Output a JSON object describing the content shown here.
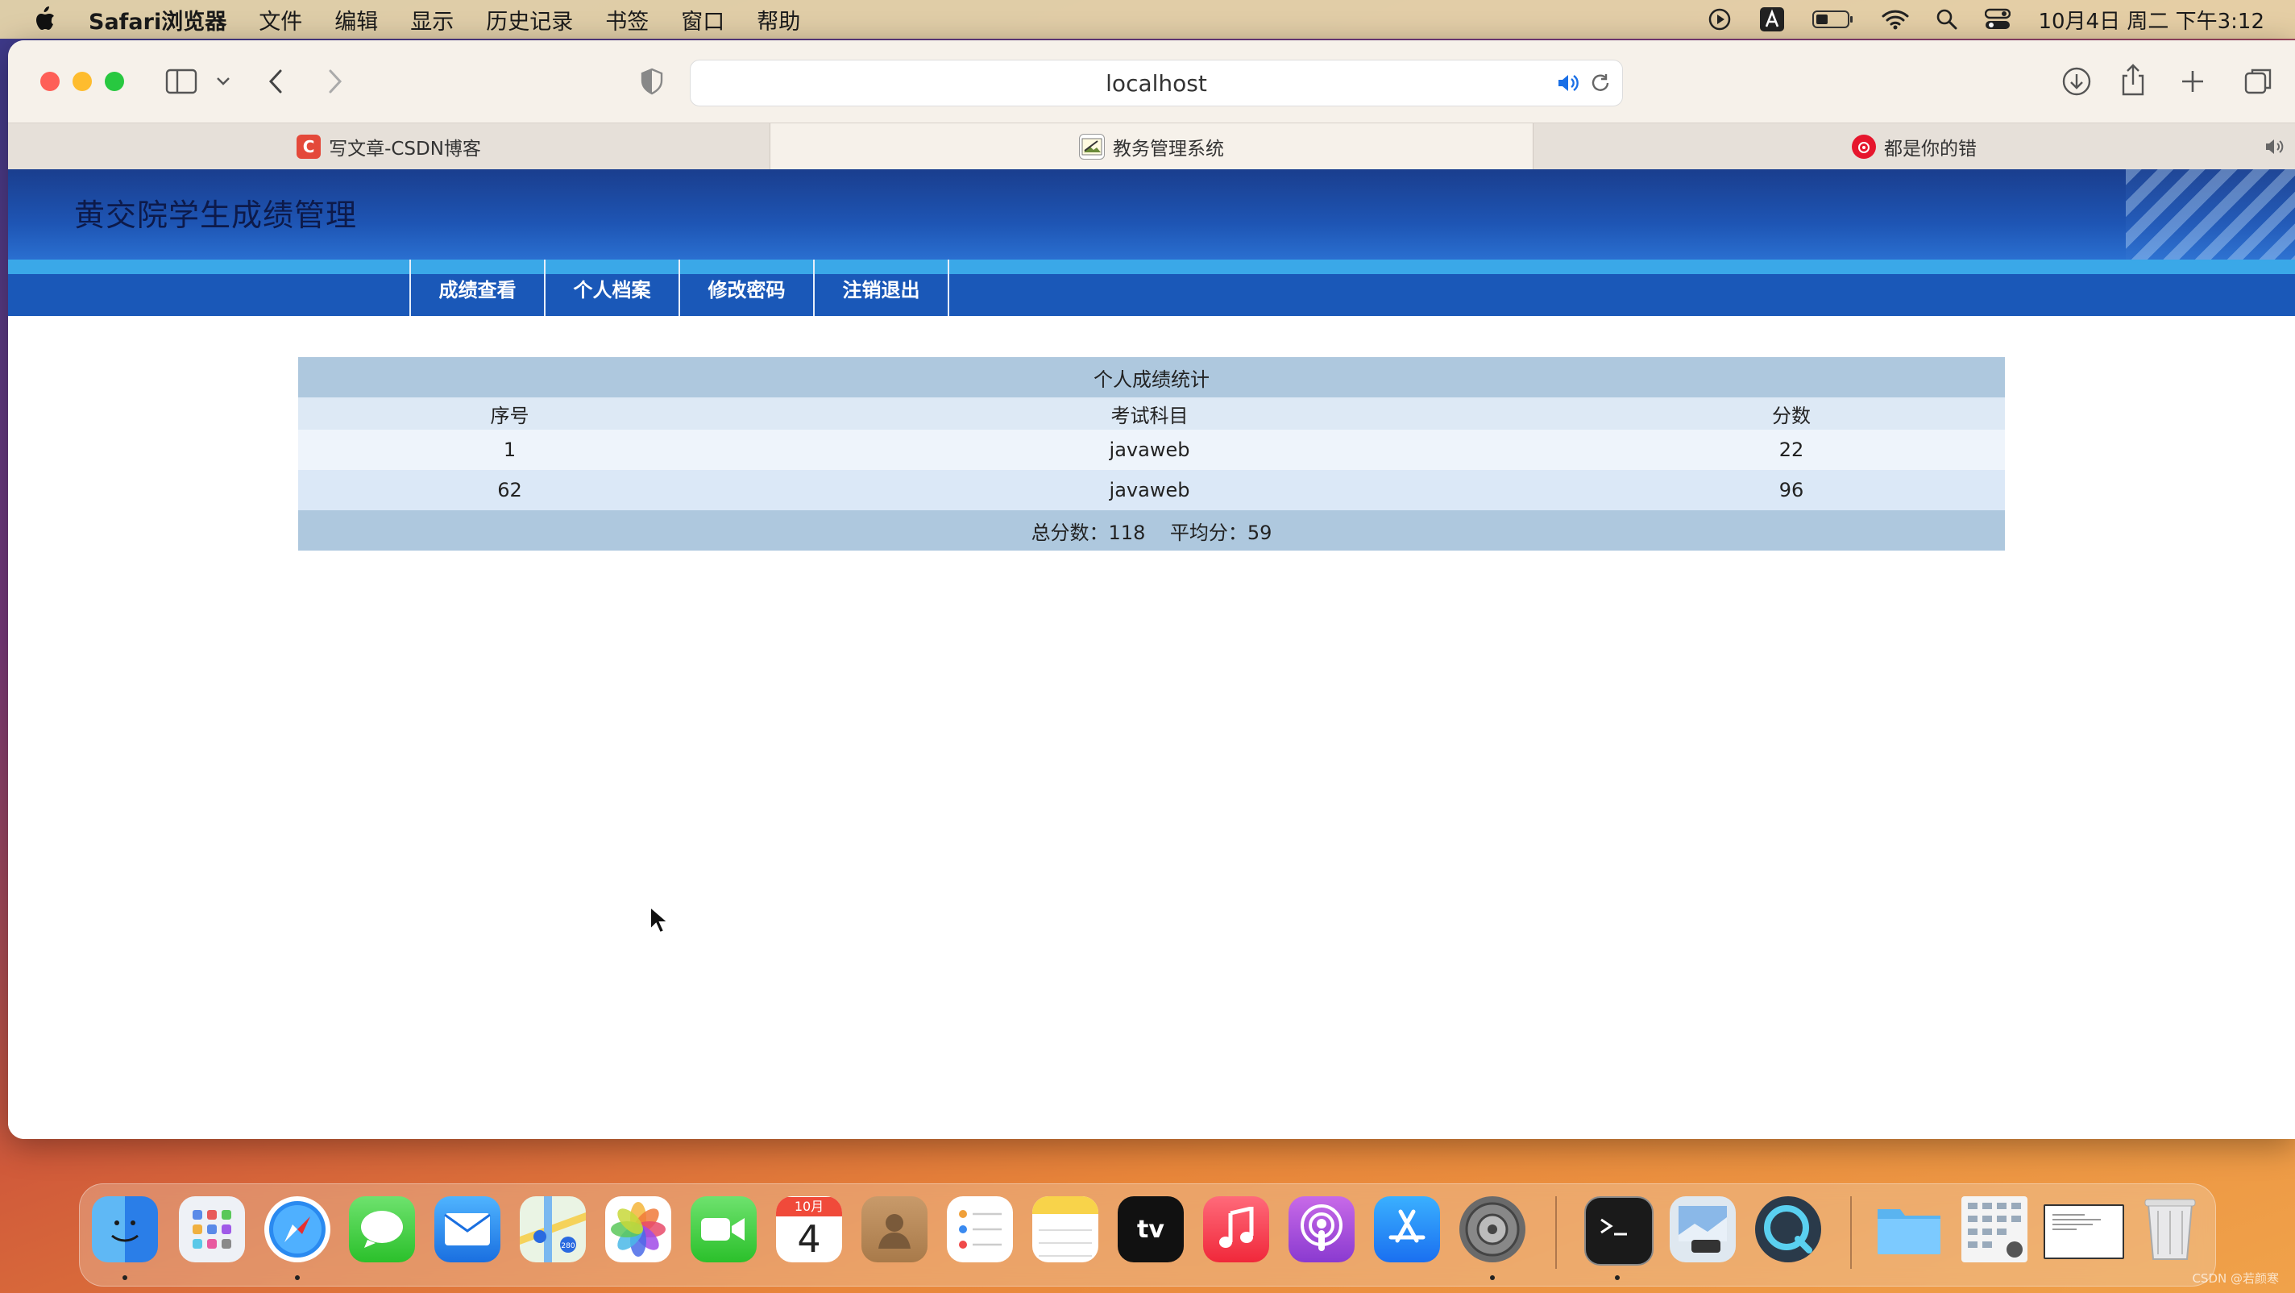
{
  "menubar": {
    "app_name": "Safari浏览器",
    "menus": [
      "文件",
      "编辑",
      "显示",
      "历史记录",
      "书签",
      "窗口",
      "帮助"
    ],
    "clock": "10月4日 周二 下午3:12"
  },
  "browser": {
    "url": "localhost",
    "tabs": [
      {
        "label": "写文章-CSDN博客",
        "fav": "C",
        "color": "#e4493a"
      },
      {
        "label": "教务管理系统",
        "fav": "img"
      },
      {
        "label": "都是你的错",
        "fav": "weibo",
        "color": "#e6162d"
      }
    ]
  },
  "site": {
    "title": "黄交院学生成绩管理",
    "nav": [
      "成绩查看",
      "个人档案",
      "修改密码",
      "注销退出"
    ]
  },
  "scores": {
    "caption": "个人成绩统计",
    "columns": [
      "序号",
      "考试科目",
      "分数"
    ],
    "rows": [
      {
        "id": "1",
        "subject": "javaweb",
        "score": "22"
      },
      {
        "id": "62",
        "subject": "javaweb",
        "score": "96"
      }
    ],
    "summary": "总分数：118    平均分：59"
  },
  "dock": {
    "apps": [
      "finder-icon",
      "launchpad-icon",
      "safari-icon",
      "messages-icon",
      "mail-icon",
      "maps-icon",
      "photos-icon",
      "facetime-icon",
      "calendar-icon",
      "contacts-icon",
      "reminders-icon",
      "notes-icon",
      "apple-tv-icon",
      "music-icon",
      "podcasts-icon",
      "app-store-icon",
      "system-preferences-icon",
      "terminal-icon",
      "preview-icon",
      "quicktime-icon",
      "folder-icon",
      "screenshot-icon",
      "window-thumb-icon",
      "trash-icon"
    ],
    "calendar_month": "10月",
    "calendar_day": "4",
    "tv_label": "tv"
  },
  "watermark": "CSDN @若颜寒"
}
